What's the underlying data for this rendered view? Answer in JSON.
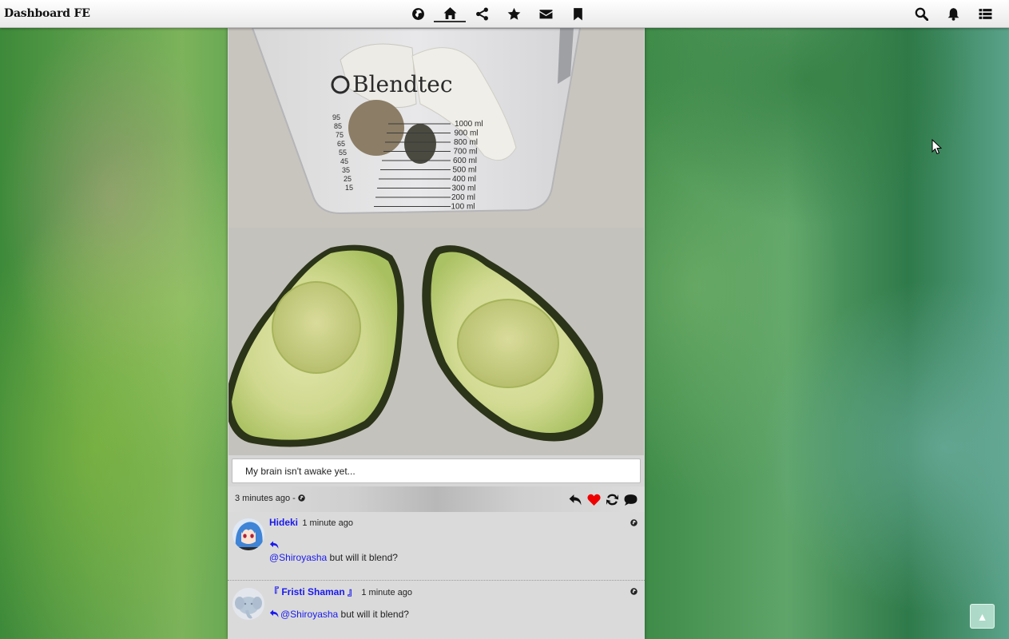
{
  "app": {
    "title": "Dashboard FE"
  },
  "nav": {
    "center": [
      {
        "icon": "globe-icon"
      },
      {
        "icon": "home-icon",
        "active": true
      },
      {
        "icon": "share-icon"
      },
      {
        "icon": "star-icon"
      },
      {
        "icon": "envelope-icon"
      },
      {
        "icon": "bookmark-icon"
      }
    ],
    "right": [
      {
        "icon": "search-icon"
      },
      {
        "icon": "bell-icon"
      },
      {
        "icon": "list-icon"
      }
    ]
  },
  "post": {
    "image_text": {
      "brand": "Blendtec",
      "ml_marks": [
        "1000",
        "900",
        "800",
        "700",
        "600",
        "500",
        "400",
        "300",
        "200",
        "100"
      ],
      "ml_unit": "ml",
      "oz_marks": [
        "95",
        "85",
        "75",
        "65",
        "55",
        "45",
        "35",
        "25",
        "15"
      ]
    },
    "text": "My brain isn't awake yet...",
    "time": "3 minutes ago - ",
    "actions": [
      "reply-icon",
      "heart-icon",
      "repeat-icon",
      "comment-icon"
    ],
    "heart_color": "#e00000"
  },
  "comments": [
    {
      "author": "Hideki",
      "time": "1 minute ago",
      "mention": "@Shiroyasha",
      "text": " but will it blend?"
    },
    {
      "author": "『 Fristi Shaman 』",
      "time": "1 minute ago",
      "mention": "@Shiroyasha",
      "text": " but will it blend?"
    }
  ],
  "scroll_top": {
    "label": "▲"
  },
  "colors": {
    "link": "#1a1aee",
    "heart": "#e00000"
  }
}
